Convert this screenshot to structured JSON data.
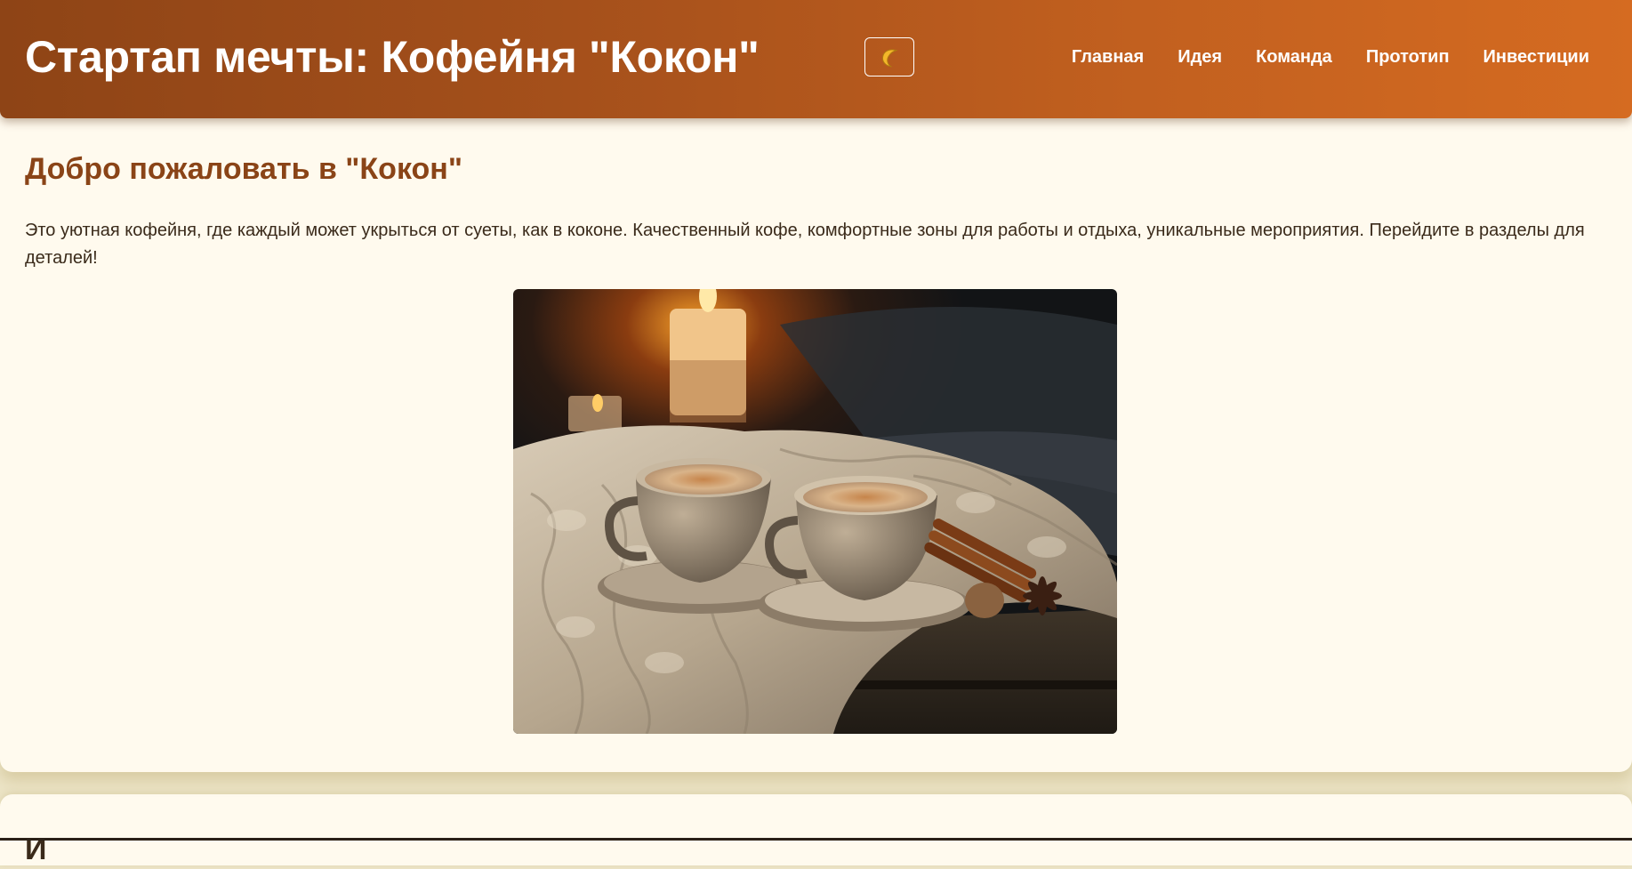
{
  "header": {
    "title": "Стартап мечты: Кофейня \"Кокон\"",
    "theme_toggle_icon": "moon-icon",
    "nav": [
      {
        "label": "Главная"
      },
      {
        "label": "Идея"
      },
      {
        "label": "Команда"
      },
      {
        "label": "Прототип"
      },
      {
        "label": "Инвестиции"
      }
    ]
  },
  "welcome": {
    "title": "Добро пожаловать в \"Кокон\"",
    "text": "Это уютная кофейня, где каждый может укрыться от суеты, как в коконе. Качественный кофе, комфортные зоны для работы и отдыха, уникальные мероприятия. Перейдите в разделы для деталей!",
    "image": "cozy-coffee-cups-photo"
  },
  "next_section": {
    "title_visible": "И"
  },
  "colors": {
    "header_gradient_start": "#8e4416",
    "header_gradient_end": "#d56b21",
    "accent_title": "#8a4417",
    "card_background": "#fffaee",
    "page_background": "#ece4c6"
  }
}
